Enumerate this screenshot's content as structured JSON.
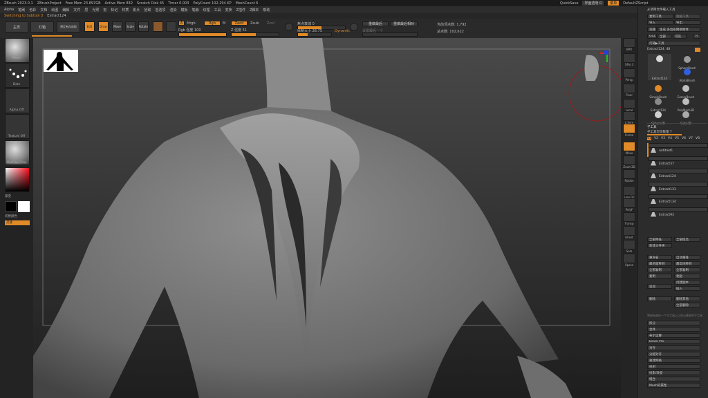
{
  "title_bar": {
    "items": [
      "ZBrush 2023.0.1",
      "ZBrushProject",
      "Free Mem 23.897GB",
      "Active Mem 832",
      "Scratch Disk 45",
      "Timer 0.003",
      "PolyCount 102.294 KP",
      "MeshCount 6"
    ]
  },
  "quick": {
    "quicksave": "QuickSave",
    "transparency": "界面透明 0",
    "menu": "菜单",
    "script": "DefaultZScript"
  },
  "menu": [
    "Alpha",
    "笔刷",
    "色彩",
    "文档",
    "绘图",
    "编辑",
    "文件",
    "层",
    "光照",
    "宏",
    "标记",
    "材质",
    "影片",
    "拾取",
    "首选项",
    "渲染",
    "模板",
    "笔触",
    "纹理",
    "工具",
    "变换",
    "Z插件",
    "Z脚本",
    "帮助"
  ],
  "status": {
    "switch": "Switching to Subtool 3",
    "name": "Extract124"
  },
  "toolbar": {
    "home": "主页",
    "lightbox": "灯箱",
    "saved": "想定有存选取",
    "edit": "Edit",
    "draw": "Draw",
    "move": "Move",
    "scale": "Scale",
    "rotate": "Rotate",
    "a": "A",
    "mrgb": "Mrgb",
    "rgb": "Rgb",
    "m": "M",
    "zadd": "Zadd",
    "zsub": "Zsub",
    "zcut": "Zcut",
    "rgb_intensity": "Rgb 强度 100",
    "z_intensity": "Z 强度 51",
    "focal": "焦点衰减 0",
    "draw_size": "绘制大小 28.75",
    "dynamic": "Dynamic",
    "last_used": "重做最后",
    "last_rel": "重做最后相对",
    "spacing": "设置最后一个",
    "active_points": "当前顶点数: 1,792",
    "total_points": "总点数: 102,622"
  },
  "left": {
    "brush": "Move",
    "stroke": "Dots",
    "alpha": "Alpha Off",
    "texture": "Texture Off",
    "material": "MatCap Gray",
    "gradient": "渐变",
    "switch_color": "切换颜色",
    "alternate": "交替"
  },
  "right_tools": [
    "BPR",
    "SPix 3",
    "Persp",
    "Floor",
    "Local",
    "L.Sym",
    "Frame",
    "Move",
    "Zoom3D",
    "Rotate",
    "Line Fill",
    "PolyF",
    "Transp",
    "Ghost",
    "Solo",
    "Xpose"
  ],
  "panel": {
    "load": "从项目文件载入工具",
    "copy": "复制工具",
    "paste": "粘贴工具",
    "import": "导入",
    "export": "导出",
    "clone": "克隆",
    "make_poly": "生成 多边形网格物体",
    "goz": "GoZ",
    "all": "全部",
    "visible": "可见",
    "r": "R",
    "lightbox_tools": "灯箱▶工具",
    "current_tool": "Extract124. 48",
    "brushes": [
      "Extract124",
      "SphereBrush",
      "AlphaBrush",
      "SimpleBrush",
      "EraserBrush",
      "Extract124",
      "PolyMesh3D",
      "Sphere3D",
      "Cube3D"
    ],
    "subtool_title": "子工具",
    "subtool_count": "子工具可见数量 7",
    "v_tabs": [
      "V1",
      "V2",
      "V3",
      "V4",
      "V5",
      "V6",
      "V7",
      "V8"
    ],
    "subtools": [
      "untitled1",
      "Extract37",
      "Extract124",
      "Extract131",
      "Extract134",
      "Extract93"
    ],
    "all_low": "全部降低",
    "all_high": "全部提高",
    "new_folder": "新建文件夹",
    "rename": "重命名",
    "auto_reorder": "自动重排",
    "all_below": "最后面移到",
    "all_above": "最高地移到",
    "dup_below": "全部复制",
    "dup_merge": "全部复制",
    "copy_tool": "复制",
    "paste_tool": "粘贴",
    "insert": "插入",
    "append": "追加",
    "new_sub": "创建副本",
    "delete": "删除",
    "del_other": "删除其他",
    "del_all": "全部删除",
    "split": "拆分",
    "merge": "合并",
    "boolean": "布尔运算",
    "bevel": "Bevel Pro",
    "align": "对齐",
    "distribute": "分配对齐",
    "remesh": "重建网格",
    "project": "投射",
    "extract": "投影/改变",
    "knit": "缝合",
    "mesh_props": "Mesh的属性",
    "hint": "将鼠标放在一个子工具上以显示最多的子工具"
  }
}
